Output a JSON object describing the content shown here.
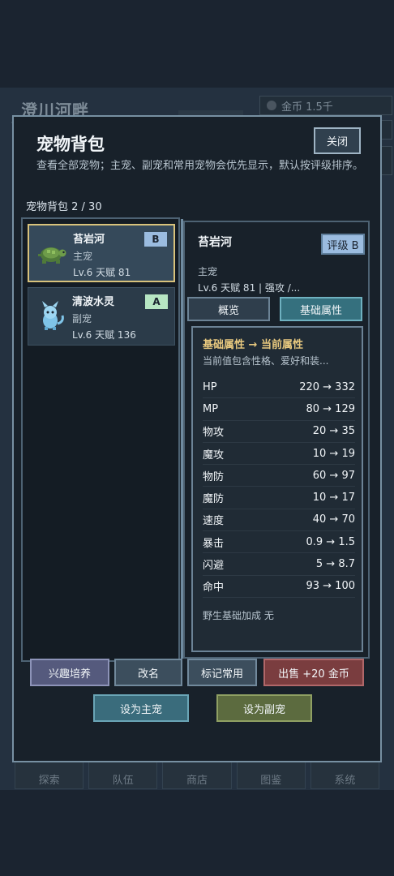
{
  "background": {
    "location_title": "澄川河畔",
    "gold": "金币 1.5千",
    "nav": [
      "探索",
      "队伍",
      "商店",
      "图鉴",
      "系统"
    ]
  },
  "modal": {
    "title": "宠物背包",
    "close_label": "关闭",
    "description": "查看全部宠物；主宠、副宠和常用宠物会优先显示，默认按评级排序。",
    "count_label": "宠物背包  2 / 30"
  },
  "pets": [
    {
      "name": "苔岩河",
      "role": "主宠",
      "stats": "Lv.6  天赋 81",
      "grade": "B",
      "icon": "turtle-icon"
    },
    {
      "name": "清波水灵",
      "role": "副宠",
      "stats": "Lv.6  天赋 136",
      "grade": "A",
      "icon": "water-spirit-icon"
    }
  ],
  "detail": {
    "name": "苔岩河",
    "grade_label": "评级 B",
    "role": "主宠",
    "stats": "Lv.6  天赋 81  |  强攻 /...",
    "tab_overview": "概览",
    "tab_basic": "基础属性",
    "attr_head": "基础属性  →  当前属性",
    "attr_sub": "当前值包含性格、爱好和装...",
    "attributes": [
      {
        "name": "HP",
        "value": "220 → 332"
      },
      {
        "name": "MP",
        "value": "80 → 129"
      },
      {
        "name": "物攻",
        "value": "20 → 35"
      },
      {
        "name": "魔攻",
        "value": "10 → 19"
      },
      {
        "name": "物防",
        "value": "60 → 97"
      },
      {
        "name": "魔防",
        "value": "10 → 17"
      },
      {
        "name": "速度",
        "value": "40 → 70"
      },
      {
        "name": "暴击",
        "value": "0.9 → 1.5"
      },
      {
        "name": "闪避",
        "value": "5 → 8.7"
      },
      {
        "name": "命中",
        "value": "93 → 100"
      }
    ],
    "wild_bonus": "野生基础加成  无"
  },
  "actions": {
    "interest": "兴趣培养",
    "rename": "改名",
    "mark": "标记常用",
    "sell": "出售 +20 金币",
    "set_main": "设为主宠",
    "set_sub": "设为副宠"
  }
}
